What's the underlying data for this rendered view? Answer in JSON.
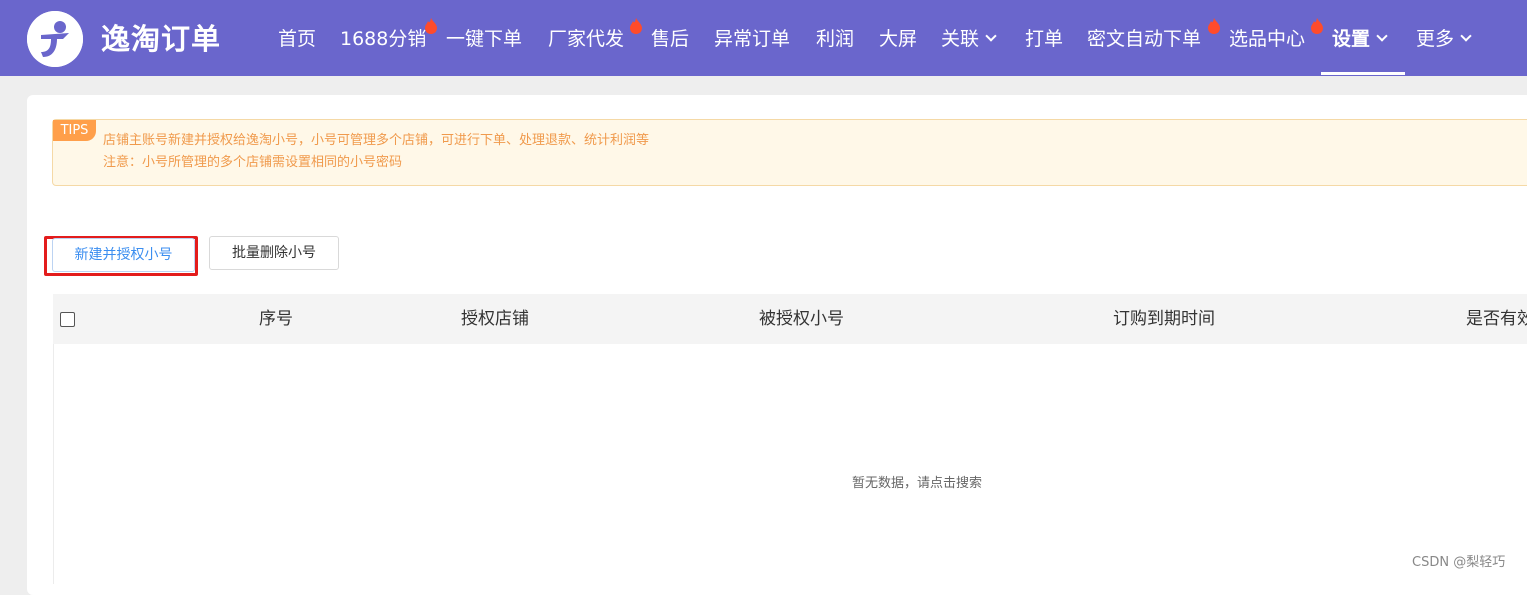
{
  "header": {
    "brand": "逸淘订单",
    "logo_icon": "yitao-logo-icon",
    "nav": [
      {
        "label": "首页"
      },
      {
        "label": "1688分销",
        "hot": true
      },
      {
        "label": "一键下单"
      },
      {
        "label": "厂家代发",
        "hot": true
      },
      {
        "label": "售后"
      },
      {
        "label": "异常订单"
      },
      {
        "label": "利润"
      },
      {
        "label": "大屏"
      },
      {
        "label": "关联",
        "dropdown": true
      },
      {
        "label": "打单"
      },
      {
        "label": "密文自动下单",
        "hot": true
      },
      {
        "label": "选品中心",
        "hot": true
      },
      {
        "label": "设置",
        "dropdown": true,
        "active": true
      },
      {
        "label": "更多",
        "dropdown": true
      }
    ],
    "colors": {
      "bar": "#6a66cc",
      "hot": "#ff4b2b"
    }
  },
  "tips": {
    "tag": "TIPS",
    "line1": "店铺主账号新建并授权给逸淘小号，小号可管理多个店铺，可进行下单、处理退款、统计利润等",
    "line2": "注意：小号所管理的多个店铺需设置相同的小号密码"
  },
  "actions": {
    "create_label": "新建并授权小号",
    "batch_delete_label": "批量删除小号"
  },
  "table": {
    "columns": [
      "序号",
      "授权店铺",
      "被授权小号",
      "订购到期时间",
      "是否有效"
    ],
    "empty_text": "暂无数据，请点击搜索"
  },
  "watermark": "CSDN @梨轻巧"
}
